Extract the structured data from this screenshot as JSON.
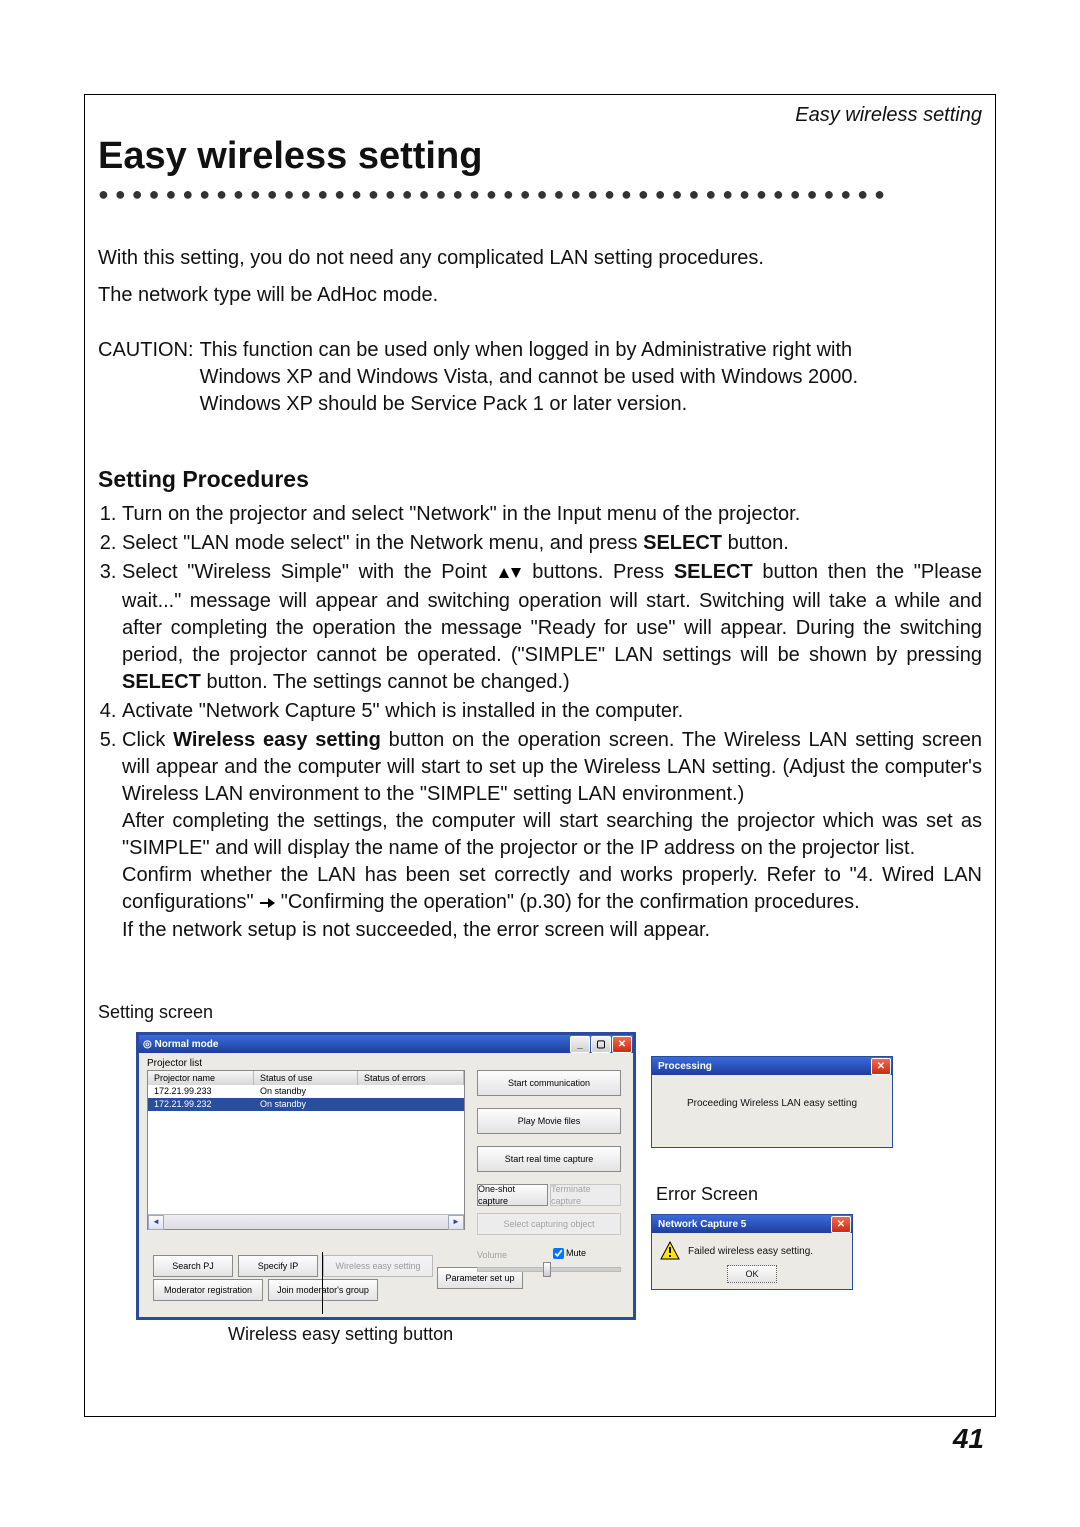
{
  "header": {
    "running_head": "Easy wireless setting"
  },
  "title": "Easy wireless setting",
  "intro": {
    "p1": "With this setting, you do not need any complicated LAN setting procedures.",
    "p2": "The network type will be AdHoc mode."
  },
  "caution": {
    "label": "CAUTION:",
    "l1": "This function can be used only when logged in by Administrative right with",
    "l2": "Windows XP and Windows Vista, and cannot be used with Windows 2000.",
    "l3": "Windows XP should be Service Pack 1 or later version."
  },
  "setting_procedures_heading": "Setting Procedures",
  "steps": {
    "s1": "Turn on the projector and select \"Network\" in the Input menu of the projector.",
    "s2": {
      "a": "Select \"LAN mode select\" in the Network menu, and press ",
      "b": "SELECT",
      "c": " button."
    },
    "s3": {
      "a": "Select \"Wireless Simple\" with the Point ",
      "b": " buttons. Press ",
      "sel": "SELECT",
      "c": " button then the \"Please wait...\" message will appear and switching operation will start. Switching will take a while and after completing the operation the message \"Ready for use\" will appear. During the switching period, the projector cannot be operated. (\"SIMPLE\" LAN settings will be shown by pressing ",
      "d": " button. The settings cannot be changed.)"
    },
    "s4": "Activate \"Network Capture 5\" which is installed in the computer.",
    "s5": {
      "a": "Click ",
      "b": "Wireless easy setting",
      "c": " button on the operation screen. The Wireless LAN setting screen will appear and the computer will start to set up the Wireless LAN setting. (Adjust the computer's Wireless LAN environment to the \"SIMPLE\" setting LAN environment.)",
      "d": "After completing the settings, the computer will start searching the projector which was set as \"SIMPLE\" and will display the name of the projector or the IP address on the projector list.",
      "e": "Confirm whether the LAN has been set correctly and works properly. Refer to \"4. Wired LAN configurations\" ",
      "f": " \"Confirming the operation\" (p.30) for the confirmation procedures.",
      "g": "If the network setup is not succeeded, the error screen will appear."
    }
  },
  "setting_screen_label": "Setting screen",
  "main_window": {
    "title": "Normal mode",
    "projector_list_label": "Projector list",
    "columns": {
      "name": "Projector name",
      "use": "Status of use",
      "err": "Status of errors"
    },
    "rows": [
      {
        "name": "172.21.99.233",
        "use": "On standby"
      },
      {
        "name": "172.21.99.232",
        "use": "On standby"
      }
    ],
    "buttons": {
      "search": "Search PJ",
      "specify": "Specify IP",
      "wireless": "Wireless easy setting",
      "modreg": "Moderator registration",
      "join": "Join moderator's group",
      "param": "Parameter set up"
    },
    "right": {
      "start_comm": "Start communication",
      "play_movie": "Play Movie files",
      "start_rt": "Start real time capture",
      "one_shot": "One-shot capture",
      "terminate": "Terminate capture",
      "select_obj": "Select capturing object",
      "volume": "Volume",
      "mute": "Mute"
    }
  },
  "proc_dialog": {
    "title": "Processing",
    "text": "Proceeding Wireless LAN easy setting"
  },
  "error_screen_label": "Error Screen",
  "err_dialog": {
    "title": "Network Capture 5",
    "text": "Failed wireless easy setting.",
    "ok": "OK"
  },
  "button_caption": "Wireless easy setting button",
  "page_number": "41"
}
